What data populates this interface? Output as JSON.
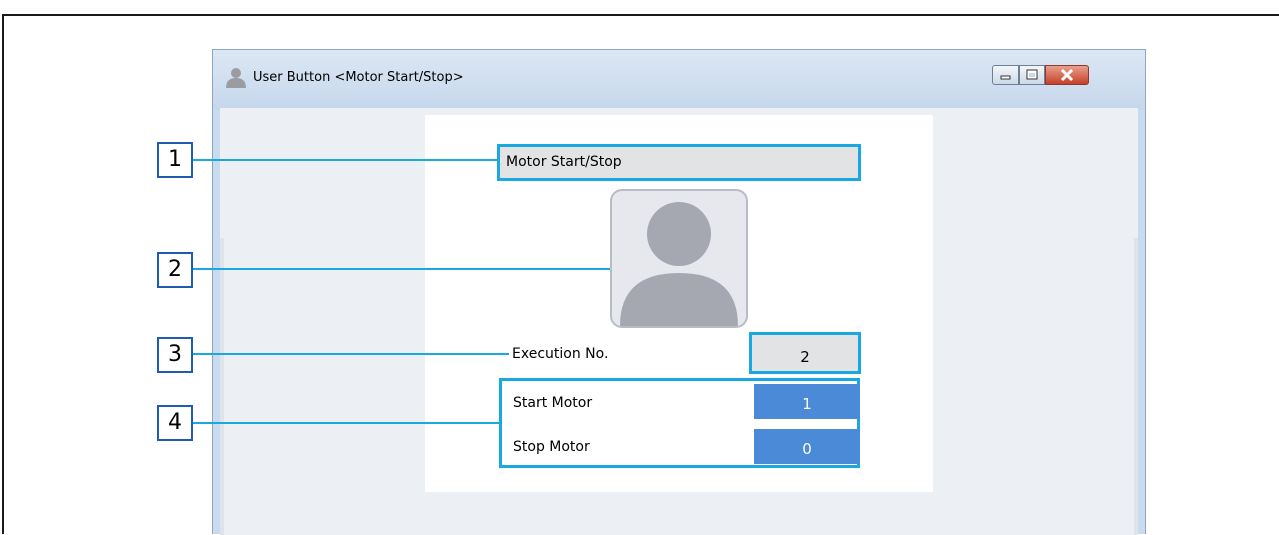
{
  "window": {
    "title": "User Button <Motor Start/Stop>",
    "title_icon": "user-icon",
    "controls": [
      "minimize-icon",
      "maximize-icon",
      "close-icon"
    ]
  },
  "panel": {
    "button_name": "Motor Start/Stop",
    "image_icon": "person-silhouette",
    "execution_label": "Execution No.",
    "execution_value": "2",
    "items": [
      {
        "label": "Start Motor",
        "value": "1"
      },
      {
        "label": "Stop Motor",
        "value": "0"
      }
    ]
  },
  "callouts": [
    "1",
    "2",
    "3",
    "4"
  ],
  "colors": {
    "highlight": "#1aa8e0",
    "value_fill": "#4a8ad6",
    "callout_border": "#1f5bb0"
  }
}
